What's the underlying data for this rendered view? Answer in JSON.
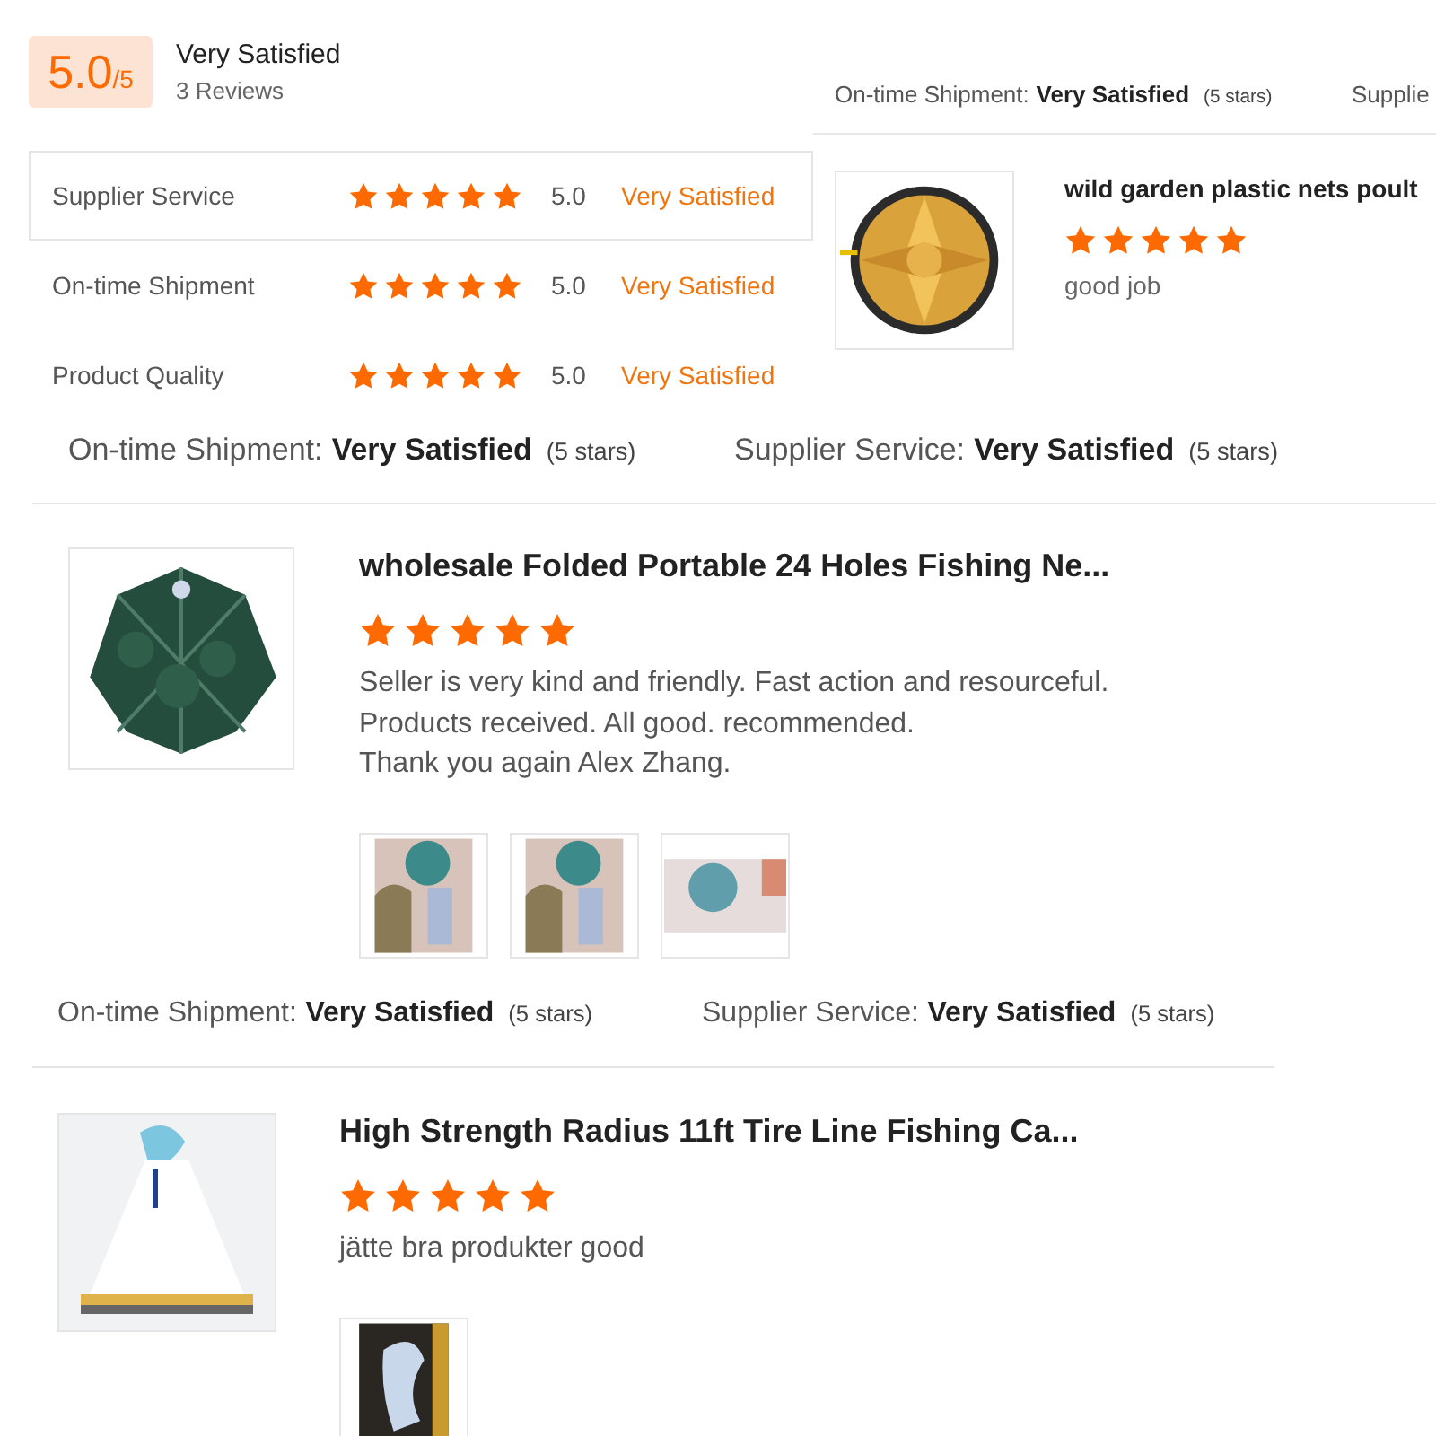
{
  "summary": {
    "score": "5.0",
    "out_of": "/5",
    "label": "Very Satisfied",
    "reviews": "3 Reviews"
  },
  "ratings": [
    {
      "name": "Supplier Service",
      "stars": 5,
      "score": "5.0",
      "label": "Very Satisfied",
      "selected": true
    },
    {
      "name": "On-time Shipment",
      "stars": 5,
      "score": "5.0",
      "label": "Very Satisfied",
      "selected": false
    },
    {
      "name": "Product Quality",
      "stars": 5,
      "score": "5.0",
      "label": "Very Satisfied",
      "selected": false
    }
  ],
  "side_review": {
    "meta": [
      {
        "label": "On-time Shipment:",
        "value": "Very Satisfied",
        "note": "(5 stars)"
      },
      {
        "label": "Supplie"
      }
    ],
    "photo": {
      "kind": "picture"
    },
    "title": "wild garden plastic nets poult",
    "stars": 5,
    "text": [
      "good job"
    ]
  },
  "blocks": [
    {
      "meta": [
        {
          "label": "On-time Shipment:",
          "value": "Very Satisfied",
          "note": "(5 stars)"
        },
        {
          "label": "Supplier Service:",
          "value": "Very Satisfied",
          "note": "(5 stars)"
        }
      ],
      "review": {
        "photo": {
          "kind": "picture"
        },
        "title": "wholesale Folded Portable 24 Holes Fishing Ne...",
        "stars": 5,
        "text": [
          "Seller is very kind and friendly. Fast action and resourceful.",
          "Products received. All good. recommended.",
          "Thank you again Alex Zhang."
        ],
        "thumbnails": [
          {
            "kind": "picture"
          },
          {
            "kind": "picture"
          },
          {
            "kind": "picture"
          }
        ]
      }
    },
    {
      "meta": [
        {
          "label": "On-time Shipment:",
          "value": "Very Satisfied",
          "note": "(5 stars)"
        },
        {
          "label": "Supplier Service:",
          "value": "Very Satisfied",
          "note": "(5 stars)"
        }
      ],
      "review": {
        "photo": {
          "kind": "picture"
        },
        "title": "High Strength Radius 11ft Tire Line Fishing Ca...",
        "stars": 5,
        "text": [
          "jätte bra produkter good"
        ],
        "thumbnails": [
          {
            "kind": "picture"
          }
        ]
      }
    }
  ]
}
